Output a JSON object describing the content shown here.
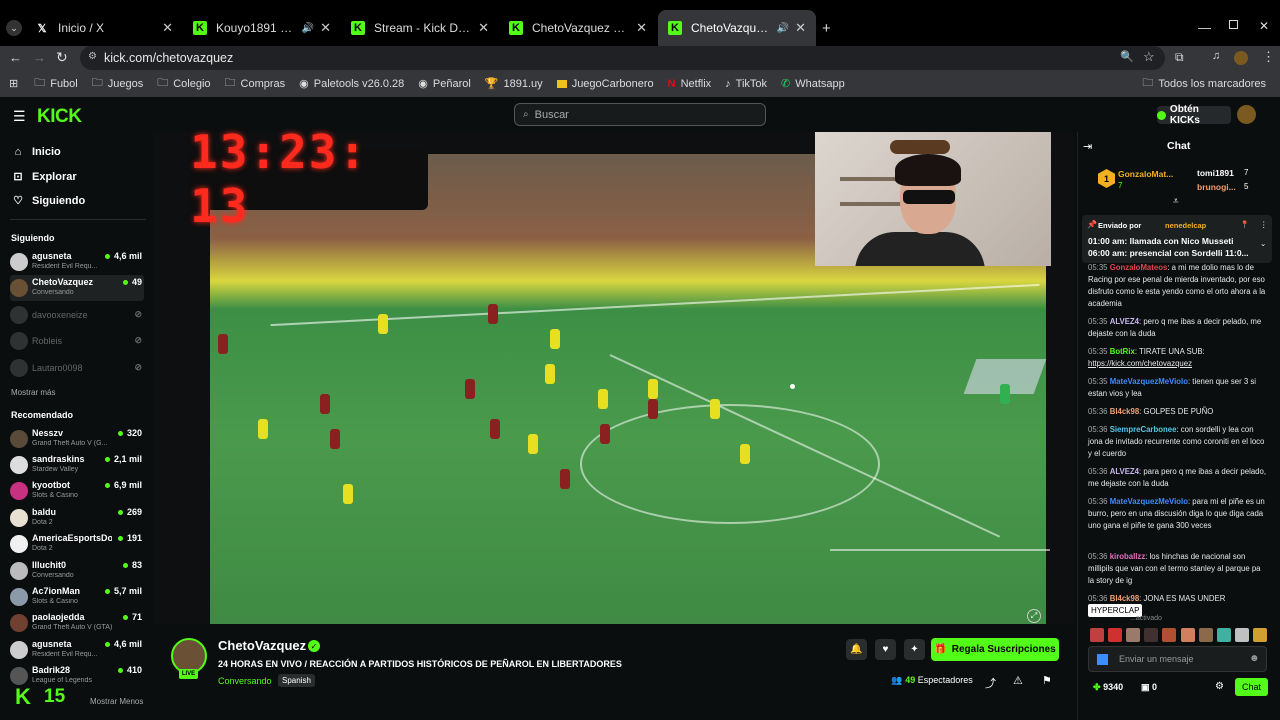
{
  "browser": {
    "tabs": [
      {
        "label": "Inicio / X",
        "icon": "x-logo"
      },
      {
        "label": "Kouyo1891 Stream - Watch",
        "icon": "kick-logo",
        "audio": true
      },
      {
        "label": "Stream - Kick Dashboard",
        "icon": "kick-logo"
      },
      {
        "label": "ChetoVazquez Stream - Kick Da",
        "icon": "kick-logo"
      },
      {
        "label": "ChetoVazquez Stream - Wa",
        "icon": "kick-logo",
        "audio": true,
        "active": true
      }
    ],
    "url": "kick.com/chetovazquez",
    "bookmarks": [
      "Fubol",
      "Juegos",
      "Colegio",
      "Compras",
      "Paletools v26.0.28",
      "Peñarol",
      "1891.uy",
      "JuegoCarbonero",
      "Netflix",
      "TikTok",
      "Whatsapp"
    ],
    "all_bookmarks": "Todos los marcadores"
  },
  "kick": {
    "logo": "KICK",
    "search_placeholder": "Buscar",
    "get_kicks": "Obtén KICKs",
    "nav": [
      "Inicio",
      "Explorar",
      "Siguiendo"
    ],
    "following_title": "Siguiendo",
    "following": [
      {
        "name": "agusneta",
        "game": "Resident Evil Requ...",
        "viewers": "4,6 mil"
      },
      {
        "name": "ChetoVazquez",
        "game": "Conversando",
        "viewers": "49"
      },
      {
        "name": "davooxeneize",
        "offline": true
      },
      {
        "name": "Robleis",
        "offline": true
      },
      {
        "name": "Lautaro0098",
        "offline": true
      }
    ],
    "show_more": "Mostrar más",
    "recommended_title": "Recomendado",
    "recommended": [
      {
        "name": "Nesszv",
        "game": "Grand Theft Auto V (G...",
        "viewers": "320"
      },
      {
        "name": "sandraskins",
        "game": "Stardew Valley",
        "viewers": "2,1 mil"
      },
      {
        "name": "kyootbot",
        "game": "Slots & Casino",
        "viewers": "6,9 mil"
      },
      {
        "name": "baldu",
        "game": "Dota 2",
        "viewers": "269"
      },
      {
        "name": "AmericaEsportsDo...",
        "game": "Dota 2",
        "viewers": "191"
      },
      {
        "name": "Illuchit0",
        "game": "Conversando",
        "viewers": "83"
      },
      {
        "name": "Ac7ionMan",
        "game": "Slots & Casino",
        "viewers": "5,7 mil"
      },
      {
        "name": "paolaojedda",
        "game": "Grand Theft Auto V (GTA)",
        "viewers": "71"
      },
      {
        "name": "agusneta",
        "game": "Resident Evil Requ...",
        "viewers": "4,6 mil"
      },
      {
        "name": "Badrik28",
        "game": "League of Legends",
        "viewers": "410"
      }
    ],
    "show_less": "Mostrar Menos",
    "overlay_logo": "K",
    "overlay_count": "15"
  },
  "video": {
    "clock": "13:23: 13"
  },
  "stream": {
    "name": "ChetoVazquez",
    "title": "24 HORAS EN VIVO / REACCIÓN A PARTIDOS HISTÓRICOS DE PEÑAROL EN LIBERTADORES",
    "category": "Conversando",
    "language": "Spanish",
    "live": "LIVE",
    "gift": "Regala Suscripciones",
    "viewers": "49",
    "viewers_label": "Espectadores"
  },
  "chat": {
    "title": "Chat",
    "leaders": [
      {
        "name": "GonzaloMat...",
        "count": "7"
      },
      {
        "name": "tomi1891",
        "count": "7"
      },
      {
        "name": "brunogi...",
        "count": "5"
      }
    ],
    "pinned": {
      "by": "Enviado por",
      "user": "nenedelcap",
      "line1": "01:00 am: llamada con Nico Musseti",
      "line2": "06:00 am: presencial con Sordelli 11:0..."
    },
    "messages": [
      {
        "time": "05:35",
        "user": "GonzaloMateos",
        "text": ": a mi me dolio mas lo de Racing por ese penal de mierda inventado, por eso disfruto como le esta yendo como el orto ahora a la academia",
        "color": "#e0454f"
      },
      {
        "time": "05:35",
        "user": "ALVEZ4",
        "text": ": pero q me ibas a decir pelado, me dejaste con la duda",
        "color": "#c8b5f0"
      },
      {
        "time": "05:35",
        "user": "BotRix",
        "text": ": TIRATE UNA SUB:",
        "link": "https://kick.com/chetovazquez",
        "color": "#53fc18"
      },
      {
        "time": "05:35",
        "user": "MateVazquezMeViolo",
        "text": ": tienen que ser 3 si estan vios y lea",
        "color": "#3c8dff"
      },
      {
        "time": "05:36",
        "user": "Bl4ck98",
        "text": ": GOLPES DE PUÑO",
        "color": "#f0a070"
      },
      {
        "time": "05:36",
        "user": "SiempreCarbonee",
        "text": ": con sordelli y lea con jona de invitado recurrente como coroniti en el loco y el cuerdo",
        "color": "#53c8e8"
      },
      {
        "time": "05:36",
        "user": "ALVEZ4",
        "text": ": para pero q me ibas a decir pelado, me dejaste con la duda",
        "color": "#c8b5f0"
      },
      {
        "time": "05:36",
        "user": "MateVazquezMeViolo",
        "text": ": para mi el piñe es un burro, pero en una discusión diga lo que diga cada uno gana el piñe te gana 300 veces",
        "color": "#3c8dff"
      },
      {
        "time": "05:36",
        "user": "kiroballzz",
        "text": ": los hinchas de nacional son millipils que van con el termo stanley al parque pa la story de ig",
        "color": "#e070c0"
      },
      {
        "time": "05:36",
        "user": "Bl4ck98",
        "text": ": JONA ES MAS UNDER",
        "color": "#f0a070"
      }
    ],
    "tooltip": "HYPERCLAP",
    "partial": "...activado",
    "input_placeholder": "Enviar un mensaje",
    "points": "9340",
    "gifts": "0",
    "send": "Chat"
  },
  "colors": {
    "accent": "#53fc18",
    "background": "#0b0e0f"
  }
}
